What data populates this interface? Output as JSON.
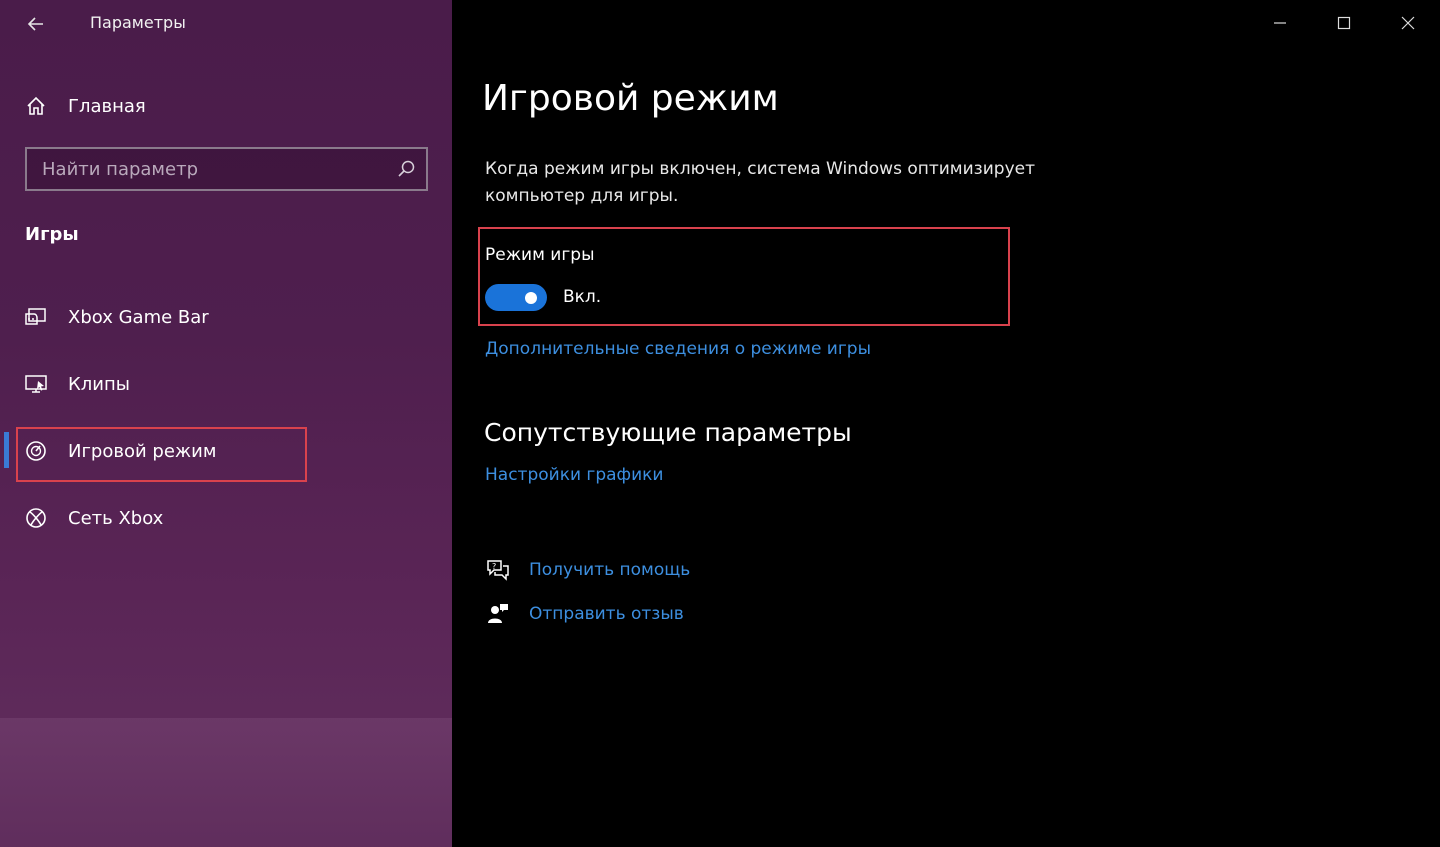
{
  "window": {
    "title": "Параметры",
    "controls": {
      "minimize": "minimize",
      "maximize": "maximize",
      "close": "close"
    }
  },
  "sidebar": {
    "home_label": "Главная",
    "search": {
      "placeholder": "Найти параметр",
      "value": ""
    },
    "section_label": "Игры",
    "items": [
      {
        "label": "Xbox Game Bar",
        "icon": "xbox-game-bar-icon"
      },
      {
        "label": "Клипы",
        "icon": "clips-icon"
      },
      {
        "label": "Игровой режим",
        "icon": "game-mode-icon",
        "selected": true
      },
      {
        "label": "Сеть Xbox",
        "icon": "xbox-icon"
      }
    ]
  },
  "main": {
    "title": "Игровой режим",
    "description": "Когда режим игры включен, система Windows оптимизирует компьютер для игры.",
    "toggle": {
      "title": "Режим игры",
      "state_label": "Вкл.",
      "on": true
    },
    "more_info_link": "Дополнительные сведения о режиме игры",
    "related": {
      "title": "Сопутствующие параметры",
      "graphics_link": "Настройки графики"
    },
    "help": {
      "get_help": "Получить помощь",
      "feedback": "Отправить отзыв"
    }
  },
  "colors": {
    "accent": "#1a73d9",
    "link": "#3d8fe0",
    "highlight": "#d9424d",
    "sidebar_bg": "#4f1f4e"
  }
}
